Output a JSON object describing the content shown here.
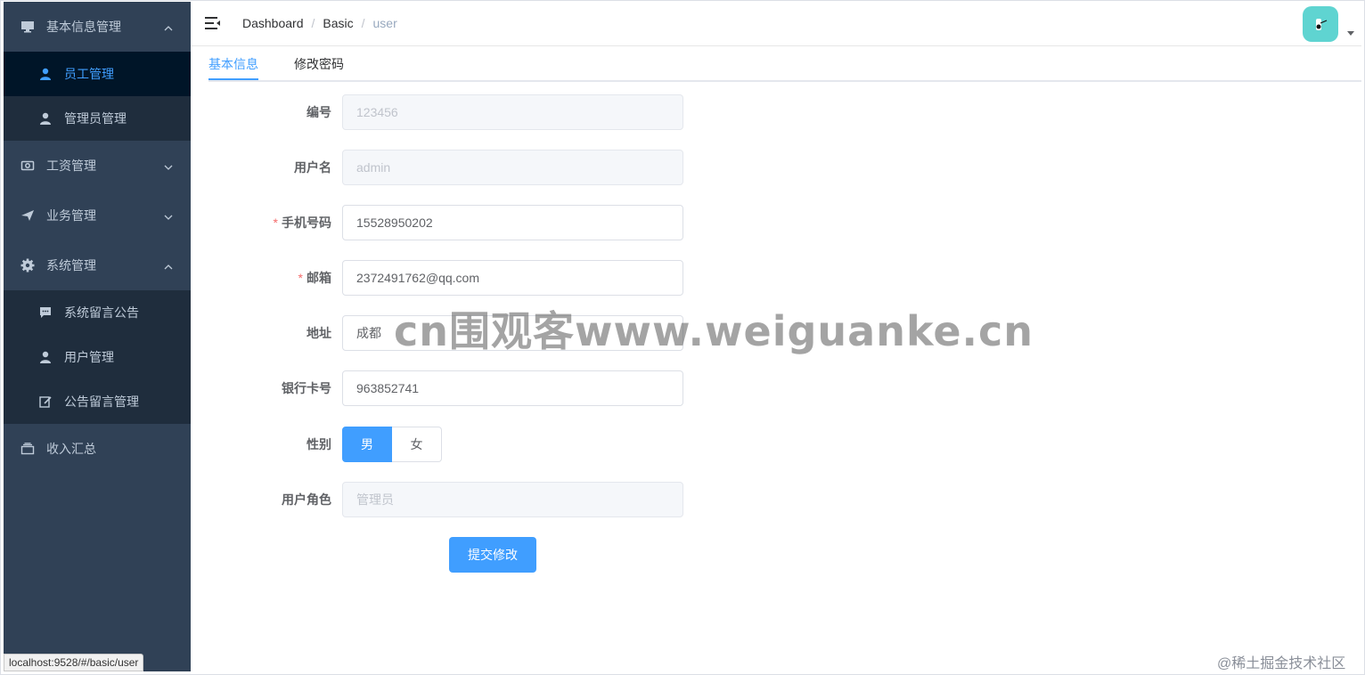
{
  "sidebar": {
    "groups": [
      {
        "label": "基本信息管理",
        "icon": "monitor-icon",
        "expanded": true,
        "items": [
          {
            "label": "员工管理",
            "icon": "user-icon",
            "active": true
          },
          {
            "label": "管理员管理",
            "icon": "user-icon",
            "active": false
          }
        ]
      },
      {
        "label": "工资管理",
        "icon": "money-icon",
        "expanded": false
      },
      {
        "label": "业务管理",
        "icon": "send-icon",
        "expanded": false
      },
      {
        "label": "系统管理",
        "icon": "gear-icon",
        "expanded": true,
        "items": [
          {
            "label": "系统留言公告",
            "icon": "message-icon"
          },
          {
            "label": "用户管理",
            "icon": "user-icon"
          },
          {
            "label": "公告留言管理",
            "icon": "edit-icon"
          }
        ]
      },
      {
        "label": "收入汇总",
        "icon": "box-icon"
      }
    ]
  },
  "status_url": "localhost:9528/#/basic/user",
  "breadcrumb": [
    "Dashboard",
    "Basic",
    "user"
  ],
  "tabs": [
    "基本信息",
    "修改密码"
  ],
  "form": {
    "id_label": "编号",
    "id_value": "123456",
    "username_label": "用户名",
    "username_value": "admin",
    "phone_label": "手机号码",
    "phone_value": "15528950202",
    "email_label": "邮箱",
    "email_value": "2372491762@qq.com",
    "address_label": "地址",
    "address_value": "成都",
    "bank_label": "银行卡号",
    "bank_value": "963852741",
    "gender_label": "性别",
    "gender_options": [
      "男",
      "女"
    ],
    "gender_selected": "男",
    "role_label": "用户角色",
    "role_value": "管理员",
    "submit_label": "提交修改",
    "required_mark": "*"
  },
  "watermark": "cn围观客www.weiguanke.cn",
  "corner_mark": "@稀土掘金技术社区",
  "colors": {
    "sidebar_bg": "#304156",
    "submenu_bg": "#1f2d3d",
    "accent": "#409eff",
    "active_bg": "#001528"
  }
}
